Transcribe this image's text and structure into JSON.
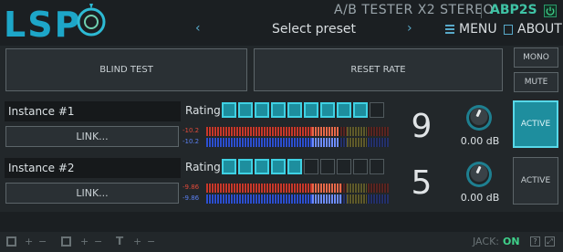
{
  "header": {
    "logo_text": "LSP",
    "plugin_title": "A/B TESTER X2 STEREO",
    "plugin_id": "ABP2S",
    "power_icon": "power-icon"
  },
  "presetbar": {
    "prev_icon": "chevron-left-icon",
    "preset_label": "Select preset",
    "next_icon": "chevron-right-icon",
    "menu_label": "MENU",
    "about_label": "ABOUT"
  },
  "controls": {
    "blind_test": "BLIND TEST",
    "reset_rate": "RESET RATE",
    "mono": "MONO",
    "mute": "MUTE"
  },
  "instances": [
    {
      "name": "Instance #1",
      "link_label": "LINK...",
      "rating_label": "Rating",
      "rating_total": 10,
      "rating_filled": 9,
      "meter_left_value": "-10.2",
      "meter_right_value": "-10.2",
      "meter_left_level": 0.73,
      "meter_right_level": 0.73,
      "rating_display": "9",
      "gain_label": "0.00 dB",
      "active_label": "ACTIVE",
      "active_on": true
    },
    {
      "name": "Instance #2",
      "link_label": "LINK...",
      "rating_label": "Rating",
      "rating_total": 10,
      "rating_filled": 5,
      "meter_left_value": "-9.86",
      "meter_right_value": "-9.86",
      "meter_left_level": 0.74,
      "meter_right_level": 0.74,
      "rating_display": "5",
      "gain_label": "0.00 dB",
      "active_label": "ACTIVE",
      "active_on": false
    }
  ],
  "footer": {
    "jack_label": "JACK:",
    "jack_status": "ON",
    "help_icon": "help-icon",
    "resize_icon": "resize-icon"
  },
  "colors": {
    "accent": "#3fc3a5",
    "rating_on": "#1d8e9e",
    "meter_red": "#c8382a",
    "meter_blue": "#2c4fcf"
  }
}
